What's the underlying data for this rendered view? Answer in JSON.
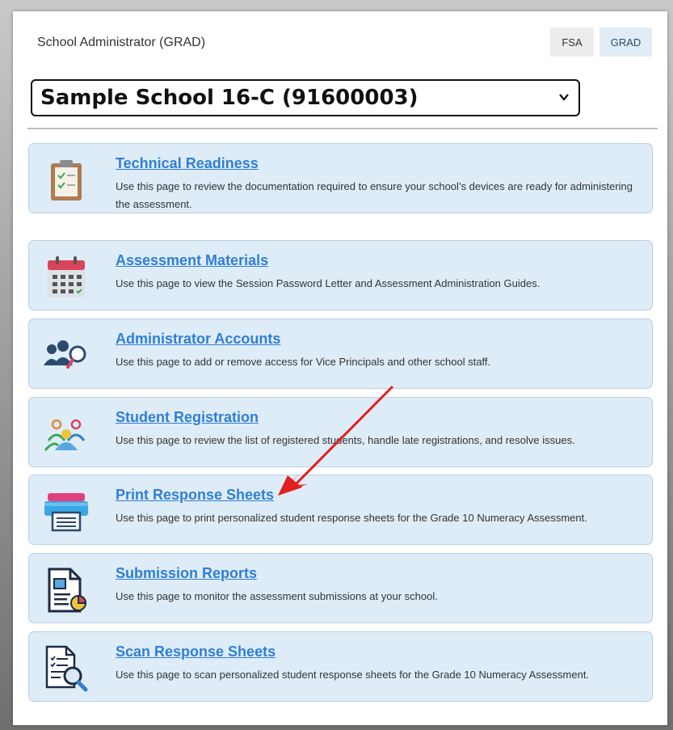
{
  "header": {
    "role_title": "School Administrator (GRAD)",
    "toggle_fsa": "FSA",
    "toggle_grad": "GRAD"
  },
  "school_select": {
    "value": "Sample School 16-C (91600003)"
  },
  "cards": [
    {
      "title": "Technical Readiness",
      "description": "Use this page to review the documentation required to ensure your school’s devices are ready for administering the assessment.",
      "icon": "clipboard-checklist-icon"
    },
    {
      "title": "Assessment Materials",
      "description": "Use this page to view the Session Password Letter and Assessment Administration Guides.",
      "icon": "calendar-icon"
    },
    {
      "title": "Administrator Accounts",
      "description": "Use this page to add or remove access for Vice Principals and other school staff.",
      "icon": "user-search-icon"
    },
    {
      "title": "Student Registration",
      "description": "Use this page to review the list of registered students, handle late registrations, and resolve issues.",
      "icon": "student-group-icon"
    },
    {
      "title": "Print Response Sheets",
      "description": "Use this page to print personalized student response sheets for the Grade 10 Numeracy Assessment.",
      "icon": "printer-icon"
    },
    {
      "title": "Submission Reports",
      "description": "Use this page to monitor the assessment submissions at your school.",
      "icon": "report-chart-icon"
    },
    {
      "title": "Scan Response Sheets",
      "description": "Use this page to scan personalized student response sheets for the Grade 10 Numeracy Assessment.",
      "icon": "document-magnifier-icon"
    }
  ],
  "colors": {
    "card_bg": "#deecf8",
    "link": "#2f7fd3",
    "annotation_arrow": "#e0201d"
  }
}
